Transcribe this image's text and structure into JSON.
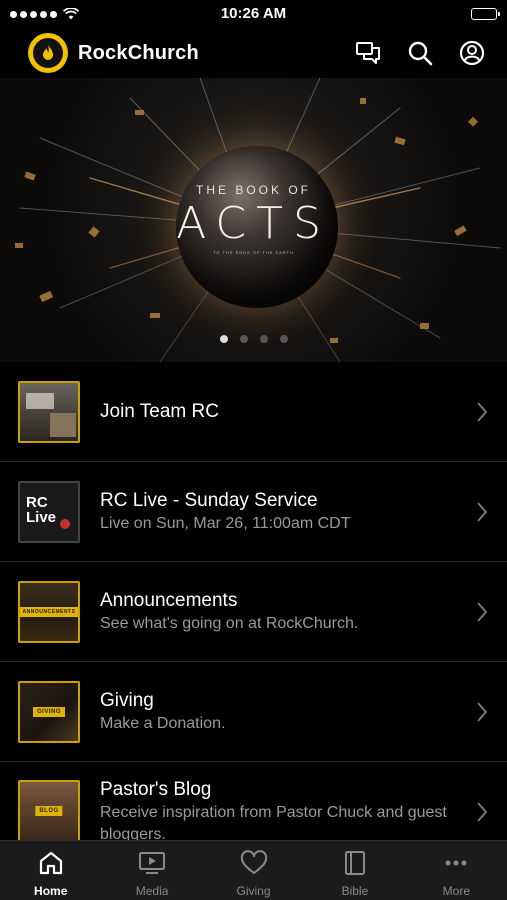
{
  "status_bar": {
    "time": "10:26 AM"
  },
  "header": {
    "title": "RockChurch",
    "icons": [
      "chat-icon",
      "search-icon",
      "profile-icon"
    ]
  },
  "hero": {
    "pre_title": "THE BOOK OF",
    "title": "ACTS",
    "subtitle": "TO THE ENDS OF THE EARTH",
    "slide_count": 4,
    "active_slide": 1
  },
  "list": {
    "items": [
      {
        "title": "Join Team RC",
        "subtitle": ""
      },
      {
        "title": "RC Live - Sunday Service",
        "subtitle": "Live on Sun, Mar 26, 11:00am CDT",
        "thumb_text": "RC Live"
      },
      {
        "title": "Announcements",
        "subtitle": "See what's going on at RockChurch.",
        "thumb_text": "ANNOUNCEMENTS"
      },
      {
        "title": "Giving",
        "subtitle": "Make a Donation.",
        "thumb_text": "GIVING"
      },
      {
        "title": "Pastor's Blog",
        "subtitle": "Receive inspiration from Pastor Chuck and guest bloggers.",
        "thumb_text": "BLOG"
      }
    ]
  },
  "tabs": [
    {
      "label": "Home",
      "icon": "home-icon",
      "active": true
    },
    {
      "label": "Media",
      "icon": "media-icon",
      "active": false
    },
    {
      "label": "Giving",
      "icon": "heart-icon",
      "active": false
    },
    {
      "label": "Bible",
      "icon": "bible-icon",
      "active": false
    },
    {
      "label": "More",
      "icon": "more-icon",
      "active": false
    }
  ],
  "colors": {
    "accent": "#f2c200",
    "background": "#000000",
    "tabbar": "#1b1b1b",
    "subtext": "#9a9a9a"
  }
}
